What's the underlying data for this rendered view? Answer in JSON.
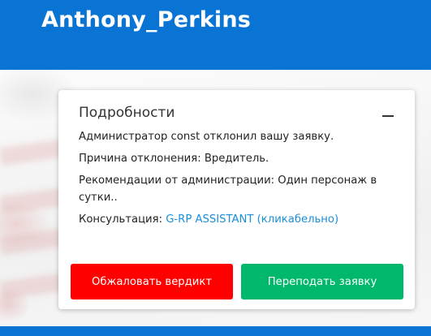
{
  "header": {
    "title": "Anthony_Perkins"
  },
  "card": {
    "title": "Подробности",
    "lines": [
      "Администратор const отклонил вашу заявку.",
      "Причина отклонения: Вредитель.",
      "Рекомендации от администрации: Один персонаж в сутки.."
    ],
    "consult_label": "Консультация: ",
    "consult_link": "G-RP ASSISTANT (кликабельно)"
  },
  "buttons": {
    "appeal": "Обжаловать вердикт",
    "resubmit": "Переподать заявку"
  },
  "colors": {
    "header_bg": "#0a74d4",
    "appeal_bg": "#ff0000",
    "resubmit_bg": "#00b86b",
    "link": "#1a8fd8"
  },
  "icons": {
    "collapse": "minus-icon"
  }
}
